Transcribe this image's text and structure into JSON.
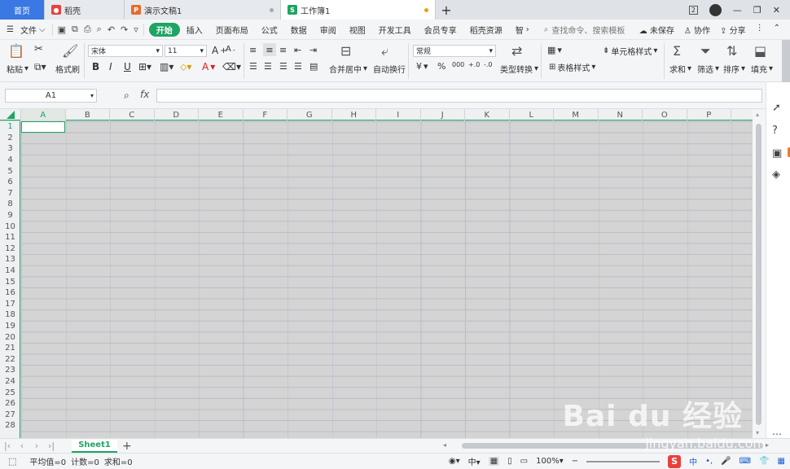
{
  "tabs": [
    {
      "label": "首页"
    },
    {
      "label": "稻壳",
      "icon": "docer-icon"
    },
    {
      "label": "演示文稿1",
      "icon": "presentation-icon"
    },
    {
      "label": "工作簿1",
      "icon": "spreadsheet-icon"
    }
  ],
  "menu": {
    "file": "文件",
    "items": [
      "开始",
      "插入",
      "页面布局",
      "公式",
      "数据",
      "审阅",
      "视图",
      "开发工具",
      "会员专享",
      "稻壳资源",
      "智"
    ],
    "search_placeholder": "查找命令、搜索模板",
    "unsaved": "未保存",
    "collab": "协作",
    "share": "分享"
  },
  "ribbon": {
    "paste": "粘贴",
    "format_painter": "格式刷",
    "font": "宋体",
    "size": "11",
    "merge": "合并居中",
    "wrap": "自动换行",
    "numfmt": "常规",
    "convert": "类型转换",
    "cond_format": "条件格式",
    "cell_style": "单元格样式",
    "table_style": "表格样式",
    "sum": "求和",
    "filter": "筛选",
    "sort": "排序",
    "fill": "填充",
    "bold": "B",
    "italic": "I",
    "underline": "U",
    "font_color": "A",
    "pct": "%",
    "thousand": "000",
    "dec_inc": "+.0",
    "dec_dec": "-.0",
    "currency": "¥"
  },
  "formula": {
    "name_box": "A1",
    "fx": "fx"
  },
  "columns": [
    "A",
    "B",
    "C",
    "D",
    "E",
    "F",
    "G",
    "H",
    "I",
    "J",
    "K",
    "L",
    "M",
    "N",
    "O",
    "P"
  ],
  "rows": [
    "1",
    "2",
    "3",
    "4",
    "5",
    "6",
    "7",
    "8",
    "9",
    "10",
    "11",
    "12",
    "13",
    "14",
    "15",
    "16",
    "17",
    "18",
    "19",
    "20",
    "21",
    "22",
    "23",
    "24",
    "25",
    "26",
    "27",
    "28"
  ],
  "sheet": {
    "name": "Sheet1",
    "add": "+"
  },
  "status": {
    "avg": "平均值=0",
    "count": "计数=0",
    "sum": "求和=0",
    "zoom": "100%",
    "ime": "中",
    "lang": "中"
  },
  "watermark": {
    "brand": "Bai du 经验",
    "url": "jingyan.baidu.com"
  }
}
